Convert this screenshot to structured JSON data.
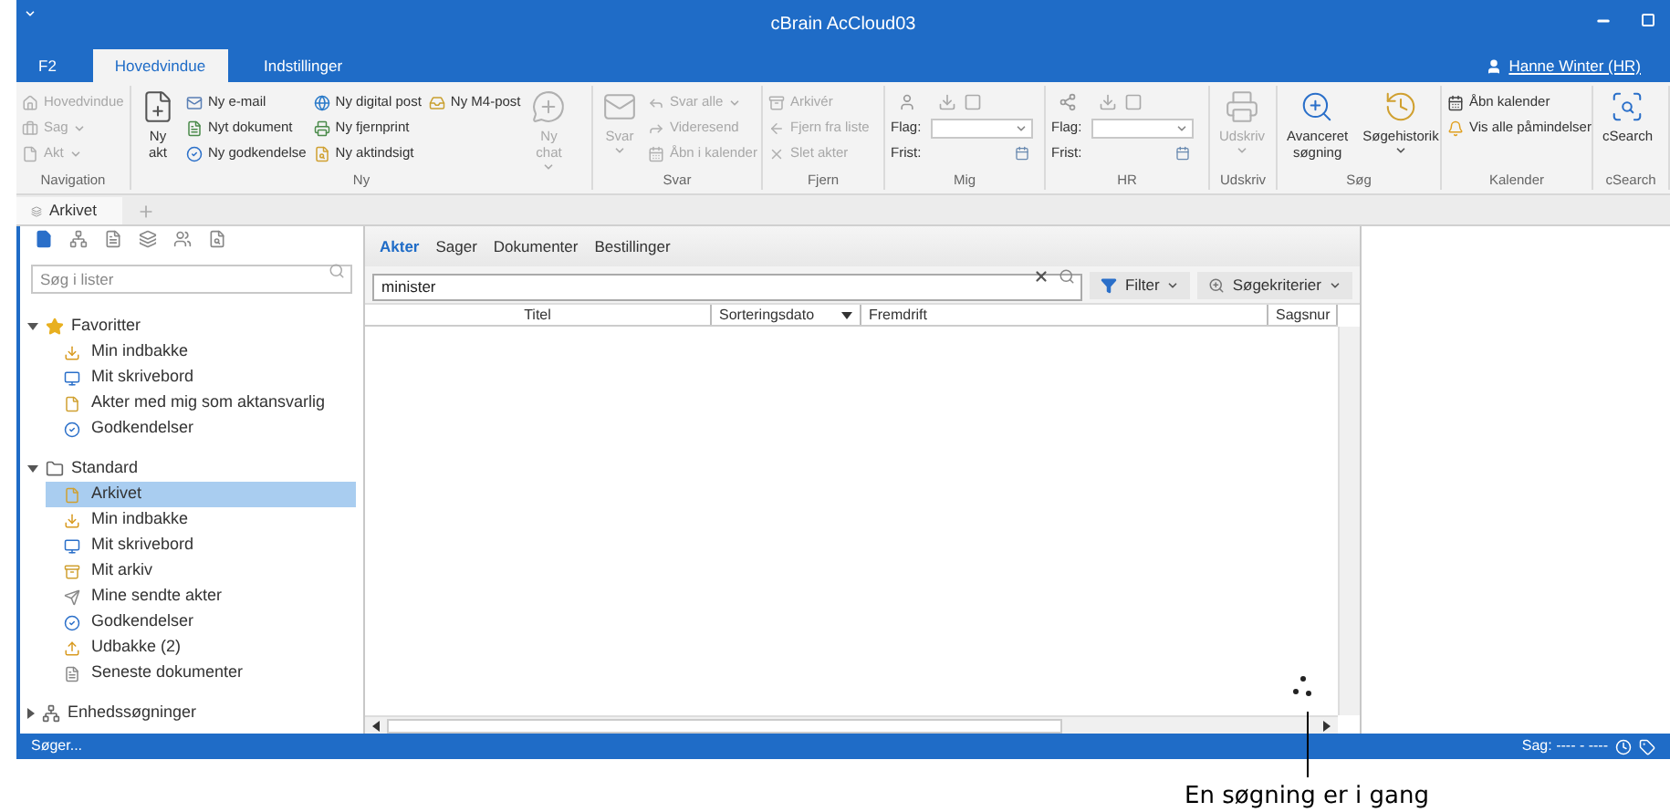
{
  "window": {
    "title": "cBrain AcCloud03",
    "user": "Hanne Winter (HR)"
  },
  "ribbon_tabs": [
    {
      "label": "F2",
      "selected": false
    },
    {
      "label": "Hovedvindue",
      "selected": true
    },
    {
      "label": "Indstillinger",
      "selected": false
    }
  ],
  "ribbon": {
    "groups": [
      {
        "label": "Navigation",
        "columns": [
          [
            {
              "kind": "small",
              "label": "Hovedvindue",
              "disabled": true,
              "dropdown": false
            },
            {
              "kind": "small",
              "label": "Sag",
              "disabled": true,
              "dropdown": true
            },
            {
              "kind": "small",
              "label": "Akt",
              "disabled": true,
              "dropdown": true
            }
          ]
        ]
      },
      {
        "label": "Ny",
        "columns": [
          [
            {
              "kind": "large",
              "label": "Ny akt",
              "disabled": false,
              "dropdown": false
            }
          ],
          [
            {
              "kind": "small",
              "label": "Ny e-mail",
              "disabled": false,
              "dropdown": false
            },
            {
              "kind": "small",
              "label": "Nyt dokument",
              "disabled": false,
              "dropdown": false
            },
            {
              "kind": "small",
              "label": "Ny godkendelse",
              "disabled": false,
              "dropdown": false
            }
          ],
          [
            {
              "kind": "small",
              "label": "Ny digital post",
              "disabled": false,
              "dropdown": false
            },
            {
              "kind": "small",
              "label": "Ny fjernprint",
              "disabled": false,
              "dropdown": false
            },
            {
              "kind": "small",
              "label": "Ny aktindsigt",
              "disabled": false,
              "dropdown": false
            }
          ],
          [
            {
              "kind": "small",
              "label": "Ny M4-post",
              "disabled": false,
              "dropdown": false
            }
          ],
          [
            {
              "kind": "large",
              "label": "Ny chat",
              "disabled": true,
              "dropdown": true
            }
          ]
        ]
      },
      {
        "label": "Svar",
        "columns": [
          [
            {
              "kind": "large",
              "label": "Svar",
              "disabled": true,
              "dropdown": true
            }
          ],
          [
            {
              "kind": "small",
              "label": "Svar alle",
              "disabled": true,
              "dropdown": true
            },
            {
              "kind": "small",
              "label": "Videresend",
              "disabled": true,
              "dropdown": false
            },
            {
              "kind": "small",
              "label": "Åbn i kalender",
              "disabled": true,
              "dropdown": false
            }
          ]
        ]
      },
      {
        "label": "Fjern",
        "columns": [
          [
            {
              "kind": "small",
              "label": "Arkivér",
              "disabled": true,
              "dropdown": false
            },
            {
              "kind": "small",
              "label": "Fjern fra liste",
              "disabled": true,
              "dropdown": false
            },
            {
              "kind": "small",
              "label": "Slet akter",
              "disabled": true,
              "dropdown": false
            }
          ]
        ]
      },
      {
        "label": "Mig",
        "columns": [
          [
            {
              "kind": "icons"
            },
            {
              "kind": "select_field",
              "label": "Flag:"
            },
            {
              "kind": "date_field",
              "label": "Frist:"
            }
          ]
        ]
      },
      {
        "label": "HR",
        "columns": [
          [
            {
              "kind": "icons"
            },
            {
              "kind": "select_field",
              "label": "Flag:"
            },
            {
              "kind": "date_field",
              "label": "Frist:"
            }
          ]
        ]
      },
      {
        "label": "Udskriv",
        "columns": [
          [
            {
              "kind": "large",
              "label": "Udskriv",
              "disabled": true,
              "dropdown": true
            }
          ]
        ]
      },
      {
        "label": "Søg",
        "columns": [
          [
            {
              "kind": "large",
              "label": "Avanceret søgning",
              "disabled": false,
              "dropdown": false
            }
          ],
          [
            {
              "kind": "large",
              "label": "Søgehistorik",
              "disabled": false,
              "dropdown": true
            }
          ]
        ]
      },
      {
        "label": "Kalender",
        "columns": [
          [
            {
              "kind": "small",
              "label": "Åbn kalender",
              "disabled": false,
              "dropdown": false
            },
            {
              "kind": "small",
              "label": "Vis alle påmindelser",
              "disabled": false,
              "dropdown": false
            }
          ]
        ]
      },
      {
        "label": "cSearch",
        "columns": [
          [
            {
              "kind": "large",
              "label": "cSearch",
              "disabled": false,
              "dropdown": false
            }
          ]
        ]
      }
    ]
  },
  "doc_tabs": [
    {
      "label": "Arkivet",
      "selected": true
    }
  ],
  "sidebar": {
    "search": {
      "placeholder": "Søg i lister"
    },
    "tree": [
      {
        "label": "Favoritter",
        "expanded": true,
        "children": [
          {
            "label": "Min indbakke",
            "selected": false
          },
          {
            "label": "Mit skrivebord",
            "selected": false
          },
          {
            "label": "Akter med mig som aktansvarlig",
            "selected": false
          },
          {
            "label": "Godkendelser",
            "selected": false
          }
        ]
      },
      {
        "label": "Standard",
        "expanded": true,
        "children": [
          {
            "label": "Arkivet",
            "selected": true
          },
          {
            "label": "Min indbakke",
            "selected": false
          },
          {
            "label": "Mit skrivebord",
            "selected": false
          },
          {
            "label": "Mit arkiv",
            "selected": false
          },
          {
            "label": "Mine sendte akter",
            "selected": false
          },
          {
            "label": "Godkendelser",
            "selected": false
          },
          {
            "label": "Udbakke (2)",
            "selected": false
          },
          {
            "label": "Seneste dokumenter",
            "selected": false
          }
        ]
      },
      {
        "label": "Enhedssøgninger",
        "expanded": false
      }
    ]
  },
  "main": {
    "tabs": [
      {
        "label": "Akter",
        "selected": true
      },
      {
        "label": "Sager",
        "selected": false
      },
      {
        "label": "Dokumenter",
        "selected": false
      },
      {
        "label": "Bestillinger",
        "selected": false
      }
    ],
    "search": {
      "value": "minister"
    },
    "buttons": [
      "Filter",
      "Søgekriterier"
    ],
    "table": {
      "columns": [
        {
          "label": "Titel",
          "sorted": false
        },
        {
          "label": "Sorteringsdato",
          "sorted": true
        },
        {
          "label": "Fremdrift",
          "sorted": false
        },
        {
          "label": "Sagsnur",
          "sorted": false
        }
      ]
    },
    "busy": true
  },
  "status_bar": {
    "left": "Søger...",
    "right": "Sag: ---- - ----"
  },
  "callout": {
    "text": "En søgning er i gang"
  }
}
